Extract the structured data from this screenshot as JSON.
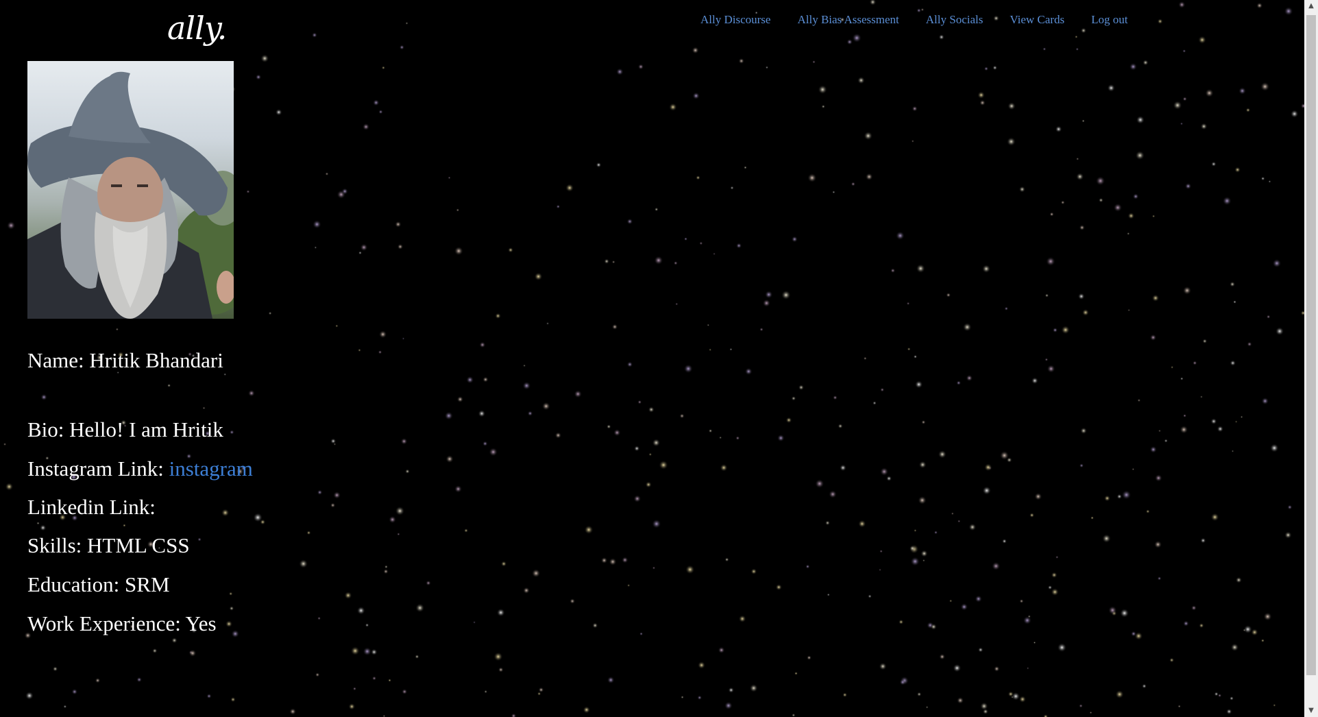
{
  "brand": {
    "logo_text": "ally."
  },
  "nav": {
    "items": [
      {
        "label": "Ally Discourse"
      },
      {
        "label": "Ally Bias Assessment"
      },
      {
        "label": "Ally Socials"
      },
      {
        "label": "View Cards"
      },
      {
        "label": "Log out"
      }
    ]
  },
  "profile": {
    "name_label": "Name: Hritik Bhandari",
    "bio_label": "Bio: Hello! I am Hritik",
    "instagram_prefix": "Instagram Link: ",
    "instagram_link_text": "instagram",
    "linkedin_label": "Linkedin Link:",
    "skills_label": "Skills: HTML CSS",
    "education_label": "Education: SRM",
    "work_label": "Work Experience: Yes"
  },
  "colors": {
    "background": "#000000",
    "nav_link": "#5b8fd6",
    "link": "#3d7fd6",
    "text": "#ffffff"
  },
  "icons": {
    "scroll_up": "chevron-up-icon",
    "scroll_down": "chevron-down-icon"
  }
}
